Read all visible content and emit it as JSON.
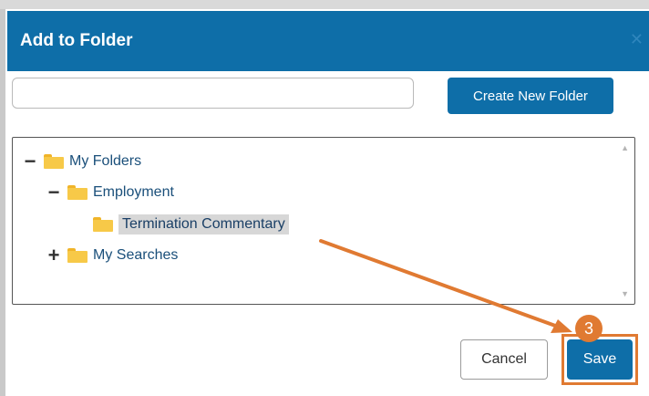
{
  "dialog": {
    "title": "Add to Folder",
    "close_icon": "close-icon"
  },
  "search": {
    "value": "",
    "placeholder": ""
  },
  "toolbar": {
    "create_label": "Create New Folder"
  },
  "tree": {
    "root": {
      "toggle": "−",
      "label": "My Folders"
    },
    "employment": {
      "toggle": "−",
      "label": "Employment"
    },
    "termination": {
      "label": "Termination Commentary",
      "selected": true
    },
    "searches": {
      "toggle": "+",
      "label": "My Searches"
    }
  },
  "footer": {
    "cancel_label": "Cancel",
    "save_label": "Save"
  },
  "annotation": {
    "step": "3",
    "color": "#e07a32"
  },
  "colors": {
    "header": "#0e6ea8",
    "folder": "#f7c948",
    "selection": "#d7d7d7"
  }
}
